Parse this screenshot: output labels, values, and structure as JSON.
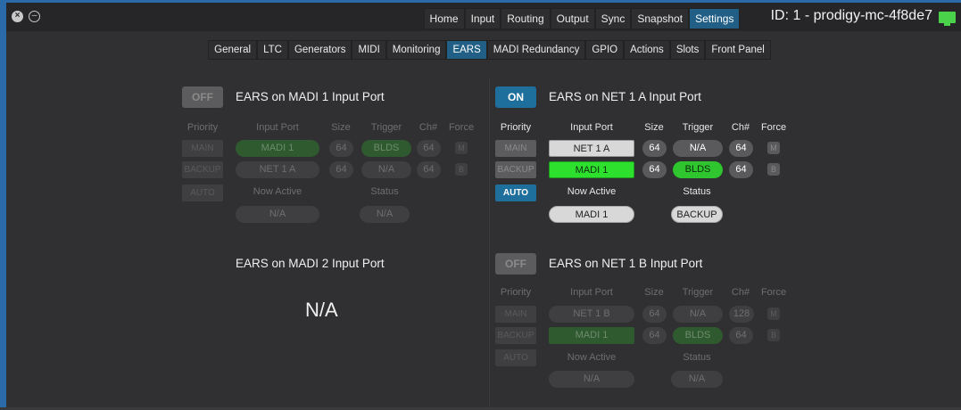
{
  "window": {
    "device_id": "ID: 1 - prodigy-mc-4f8de7",
    "status_icon": "monitor-icon",
    "status_color": "#4ad34a"
  },
  "top_nav": [
    "Home",
    "Input",
    "Routing",
    "Output",
    "Sync",
    "Snapshot",
    "Settings"
  ],
  "top_nav_active": "Settings",
  "sub_nav": [
    "General",
    "LTC",
    "Generators",
    "MIDI",
    "Monitoring",
    "EARS",
    "MADI Redundancy",
    "GPIO",
    "Actions",
    "Slots",
    "Front Panel"
  ],
  "sub_nav_active": "EARS",
  "headers": {
    "priority": "Priority",
    "input_port": "Input Port",
    "size": "Size",
    "trigger": "Trigger",
    "ch": "Ch#",
    "force": "Force",
    "now_active": "Now Active",
    "status": "Status"
  },
  "priority_buttons": {
    "main": "MAIN",
    "backup": "BACKUP",
    "auto": "AUTO"
  },
  "panels": {
    "madi1": {
      "toggle": "OFF",
      "title": "EARS on MADI 1 Input Port",
      "row1": {
        "port": "MADI 1",
        "size": "64",
        "trigger": "BLDS",
        "ch": "64",
        "force": "M"
      },
      "row2": {
        "port": "NET 1 A",
        "size": "64",
        "trigger": "N/A",
        "ch": "64",
        "force": "B"
      },
      "now_active": "N/A",
      "status": "N/A"
    },
    "net1a": {
      "toggle": "ON",
      "title": "EARS on NET 1 A Input Port",
      "row1": {
        "port": "NET 1 A",
        "size": "64",
        "trigger": "N/A",
        "ch": "64",
        "force": "M"
      },
      "row2": {
        "port": "MADI 1",
        "size": "64",
        "trigger": "BLDS",
        "ch": "64",
        "force": "B"
      },
      "now_active": "MADI 1",
      "status": "BACKUP"
    },
    "madi2": {
      "title": "EARS on MADI 2 Input Port",
      "big_value": "N/A"
    },
    "net1b": {
      "toggle": "OFF",
      "title": "EARS on NET 1 B Input Port",
      "row1": {
        "port": "NET 1 B",
        "size": "64",
        "trigger": "N/A",
        "ch": "128",
        "force": "M"
      },
      "row2": {
        "port": "MADI 1",
        "size": "64",
        "trigger": "BLDS",
        "ch": "64",
        "force": "B"
      },
      "now_active": "N/A",
      "status": "N/A"
    }
  }
}
